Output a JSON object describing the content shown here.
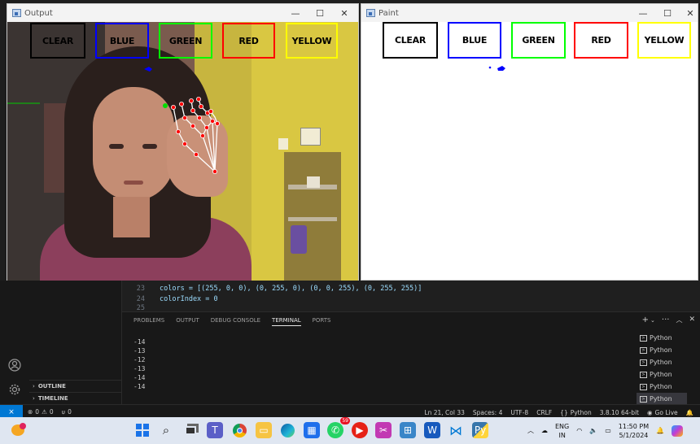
{
  "output_window": {
    "title": "Output",
    "color_buttons": [
      "CLEAR",
      "BLUE",
      "GREEN",
      "RED",
      "YELLOW"
    ]
  },
  "paint_window": {
    "title": "Paint",
    "color_buttons": [
      "CLEAR",
      "BLUE",
      "GREEN",
      "RED",
      "YELLOW"
    ]
  },
  "button_colors": {
    "CLEAR": "#000000",
    "BLUE": "#0000ff",
    "GREEN": "#00ff00",
    "RED": "#ff0000",
    "YELLOW": "#ffff00"
  },
  "editor": {
    "lines": [
      {
        "num": "23",
        "code": "colors = [(255, 0, 0), (0, 255, 0), (0, 0, 255), (0, 255, 255)]"
      },
      {
        "num": "24",
        "code": "colorIndex = 0"
      },
      {
        "num": "25",
        "code": ""
      }
    ]
  },
  "panel": {
    "tabs": [
      "PROBLEMS",
      "OUTPUT",
      "DEBUG CONSOLE",
      "TERMINAL",
      "PORTS"
    ],
    "active_tab": "TERMINAL",
    "terminal_output": [
      "-14",
      "-13",
      "-12",
      "-13",
      "-14",
      "-14"
    ],
    "terminals": [
      "Python",
      "Python",
      "Python",
      "Python",
      "Python",
      "Python"
    ]
  },
  "sidebar": {
    "outline": "OUTLINE",
    "timeline": "TIMELINE"
  },
  "statusbar": {
    "errors": "0",
    "warnings": "0",
    "ports": "0",
    "position": "Ln 21, Col 33",
    "spaces": "Spaces: 4",
    "encoding": "UTF-8",
    "eol": "CRLF",
    "language": "Python",
    "interpreter": "3.8.10 64-bit",
    "golive": "Go Live"
  },
  "taskbar": {
    "whatsapp_badge": "59",
    "lang_top": "ENG",
    "lang_bottom": "IN",
    "time": "11:50 PM",
    "date": "5/1/2024"
  }
}
